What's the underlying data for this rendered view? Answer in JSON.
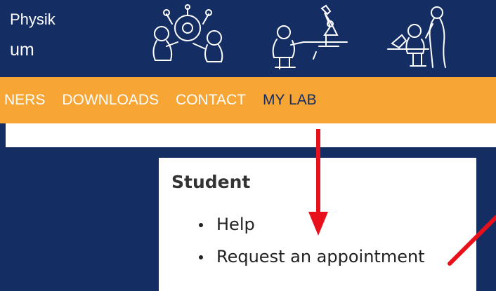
{
  "site": {
    "name_line1": "Physik",
    "name_line2": "um"
  },
  "nav": {
    "items": [
      {
        "label": "NERS",
        "active": false
      },
      {
        "label": "DOWNLOADS",
        "active": false
      },
      {
        "label": "CONTACT",
        "active": false
      },
      {
        "label": "MY LAB",
        "active": true
      }
    ]
  },
  "panel": {
    "title": "Student",
    "items": [
      "Help",
      "Request an appointment"
    ]
  },
  "colors": {
    "background": "#142d63",
    "nav_bar": "#f7a535",
    "annotation_arrow": "#e8101a"
  }
}
